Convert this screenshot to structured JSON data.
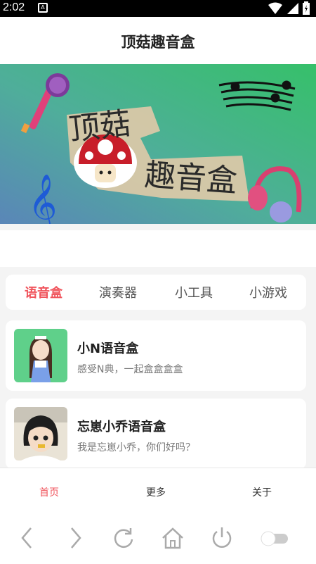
{
  "status_bar": {
    "time": "2:02",
    "notification_icon": "a-icon",
    "icons": [
      "wifi-icon",
      "signal-icon",
      "battery-icon"
    ]
  },
  "header": {
    "title": "顶菇趣音盒"
  },
  "banner": {
    "title_line1": "顶菇",
    "title_line2": "趣音盒",
    "decorations": [
      "microphone-icon",
      "mushroom-icon",
      "music-notes-icon",
      "treble-clef-icon",
      "headphones-icon"
    ]
  },
  "tabs": [
    {
      "label": "语音盒",
      "active": true
    },
    {
      "label": "演奏器",
      "active": false
    },
    {
      "label": "小工具",
      "active": false
    },
    {
      "label": "小游戏",
      "active": false
    }
  ],
  "cards": [
    {
      "title": "小N语音盒",
      "description": "感受N典，一起盒盒盒盒",
      "thumb": "anime-girl-blue-dress"
    },
    {
      "title": "忘崽小乔语音盒",
      "description": "我是忘崽小乔，你们好吗？",
      "thumb": "anime-girl-short-hair"
    }
  ],
  "bottom_nav": [
    {
      "label": "首页",
      "active": true
    },
    {
      "label": "更多",
      "active": false
    },
    {
      "label": "关于",
      "active": false
    }
  ],
  "system_bar": {
    "buttons": [
      "back-icon",
      "forward-icon",
      "refresh-icon",
      "home-icon",
      "power-icon",
      "toggle-switch"
    ]
  },
  "colors": {
    "accent": "#f0545c",
    "background": "#f4f4f4",
    "banner_green": "#3dbd73",
    "banner_blue": "#5a86b8"
  }
}
